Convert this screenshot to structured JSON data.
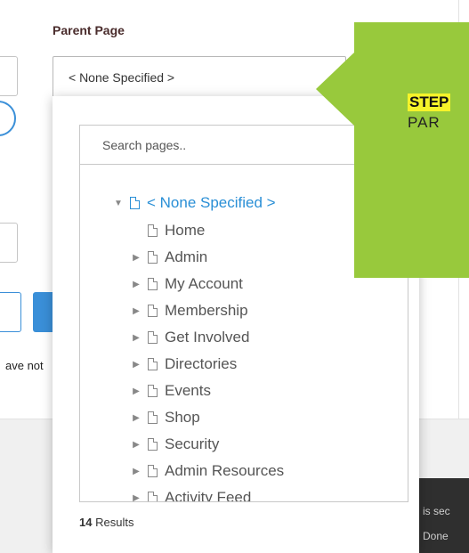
{
  "form": {
    "parent_label": "Parent Page",
    "select_value": "< None Specified >",
    "have_not_text": "ave not"
  },
  "dropdown": {
    "search_placeholder": "Search pages..",
    "tree": [
      {
        "label": "< None Specified >",
        "toggle": "▼",
        "root": true
      },
      {
        "label": "Home",
        "toggle": ""
      },
      {
        "label": "Admin",
        "toggle": "▶"
      },
      {
        "label": "My Account",
        "toggle": "▶"
      },
      {
        "label": "Membership",
        "toggle": "▶"
      },
      {
        "label": "Get Involved",
        "toggle": "▶"
      },
      {
        "label": "Directories",
        "toggle": "▶"
      },
      {
        "label": "Events",
        "toggle": "▶"
      },
      {
        "label": "Shop",
        "toggle": "▶"
      },
      {
        "label": "Security",
        "toggle": "▶"
      },
      {
        "label": "Admin Resources",
        "toggle": "▶"
      },
      {
        "label": "Activity Feed",
        "toggle": "▶"
      }
    ],
    "results_count": "14",
    "results_label": "Results"
  },
  "callout": {
    "step": "STEP",
    "sub": "PAR"
  },
  "toast": {
    "line1": "is sec",
    "line2": "Done"
  },
  "colors": {
    "accent": "#2a8fd6",
    "callout": "#98c93c",
    "highlight": "#f6f32a"
  }
}
